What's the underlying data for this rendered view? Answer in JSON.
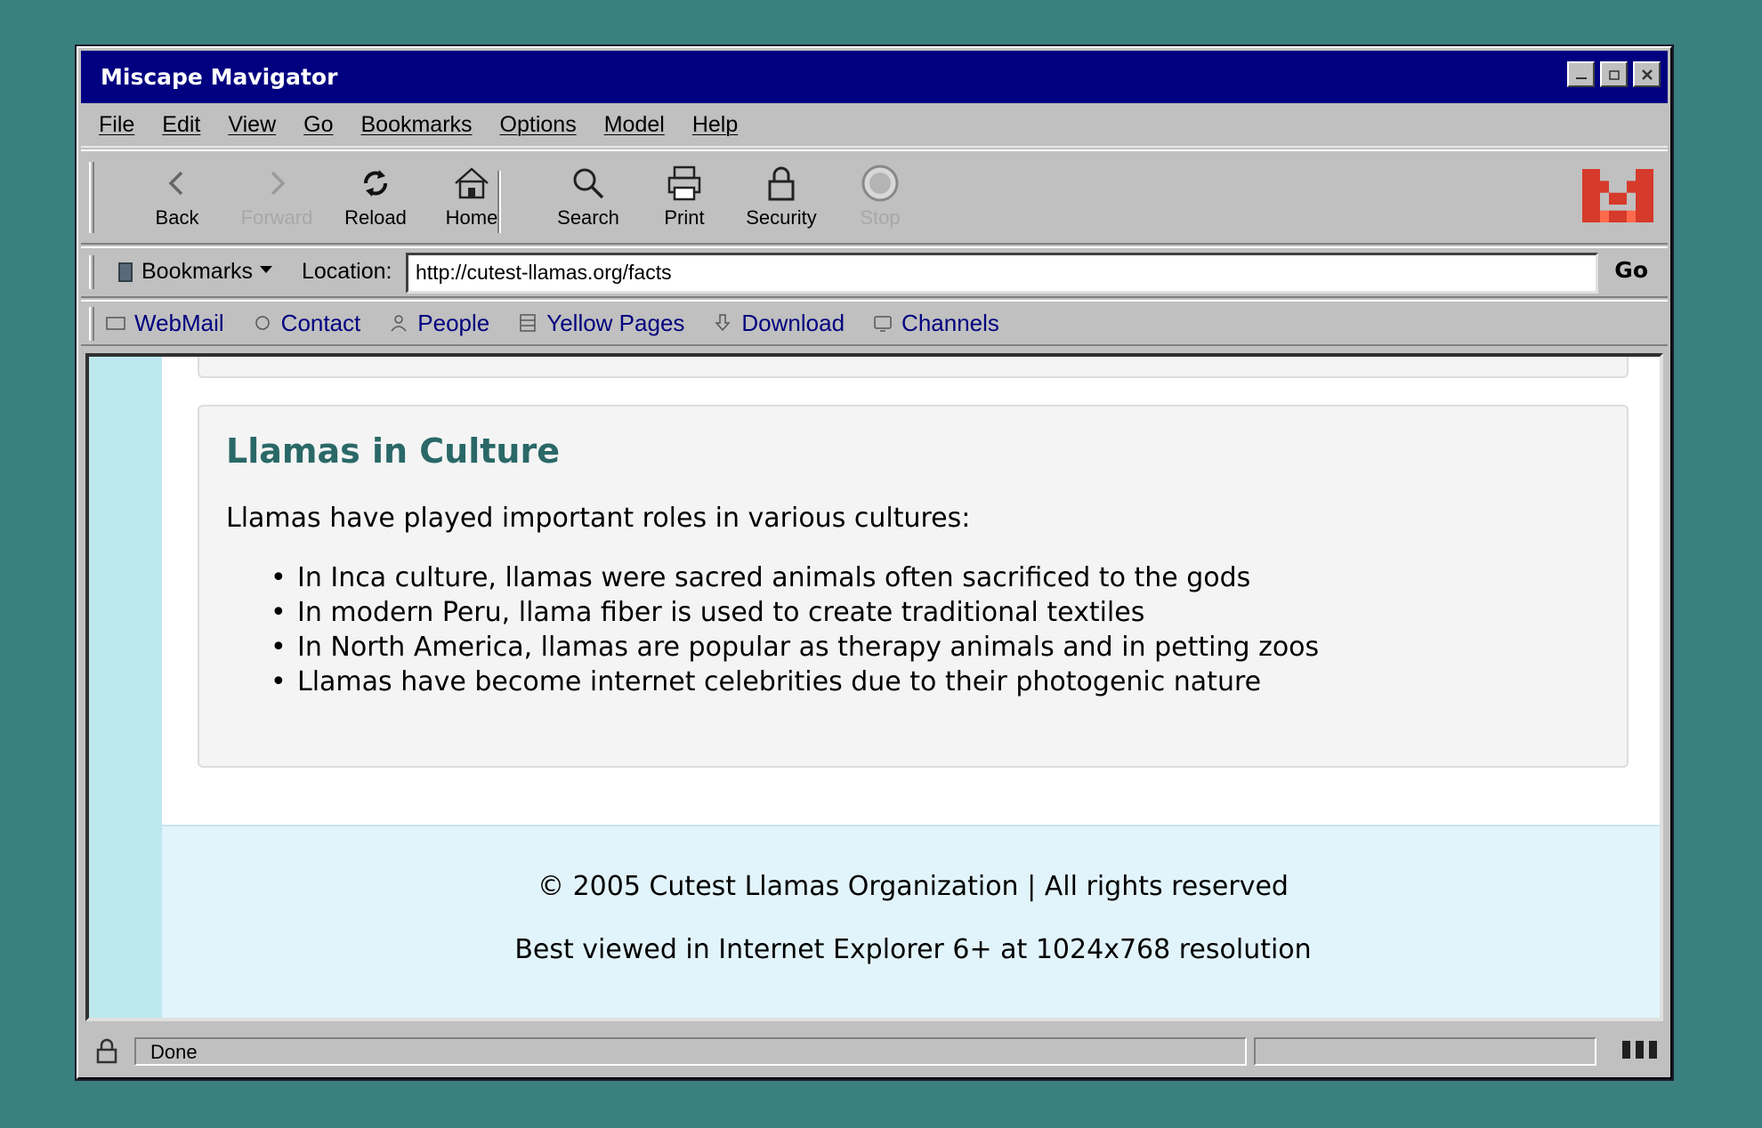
{
  "window": {
    "title": "Miscape Mavigator"
  },
  "menu": [
    "File",
    "Edit",
    "View",
    "Go",
    "Bookmarks",
    "Options",
    "Model",
    "Help"
  ],
  "toolbar": {
    "back": "Back",
    "forward": "Forward",
    "reload": "Reload",
    "home": "Home",
    "search": "Search",
    "print": "Print",
    "security": "Security",
    "stop": "Stop"
  },
  "location": {
    "bookmarks_label": "Bookmarks",
    "label": "Location:",
    "url": "http://cutest-llamas.org/facts",
    "go_label": "Go"
  },
  "personal_links": [
    "WebMail",
    "Contact",
    "People",
    "Yellow Pages",
    "Download",
    "Channels"
  ],
  "page": {
    "section_title": "Llamas in Culture",
    "intro": "Llamas have played important roles in various cultures:",
    "items": [
      "In Inca culture, llamas were sacred animals often sacrificed to the gods",
      "In modern Peru, llama fiber is used to create traditional textiles",
      "In North America, llamas are popular as therapy animals and in petting zoos",
      "Llamas have become internet celebrities due to their photogenic nature"
    ],
    "footer_line1": "© 2005 Cutest Llamas Organization | All rights reserved",
    "footer_line2": "Best viewed in Internet Explorer 6+ at 1024x768 resolution"
  },
  "status": {
    "text": "Done"
  },
  "colors": {
    "titlebar": "#000080",
    "link": "#00007f",
    "heading": "#2a6868",
    "logo": "#d63a2a"
  }
}
